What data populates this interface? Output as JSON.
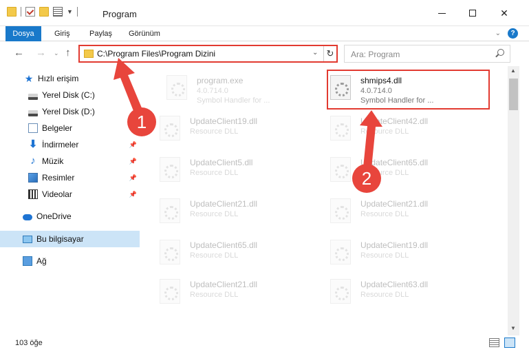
{
  "window": {
    "title": "Program"
  },
  "ribbon": {
    "tabs": [
      "Dosya",
      "Giriş",
      "Paylaş",
      "Görünüm"
    ],
    "help_label": "?"
  },
  "address": {
    "path": "C:\\Program Files\\Program Dizini",
    "search_placeholder": "Ara: Program"
  },
  "sidebar": {
    "items": [
      {
        "label": "Hızlı erişim",
        "icon": "quick-access-star-icon"
      },
      {
        "label": "Yerel Disk (C:)",
        "icon": "local-disk-icon"
      },
      {
        "label": "Yerel Disk (D:)",
        "icon": "local-disk-icon"
      },
      {
        "label": "Belgeler",
        "icon": "documents-icon"
      },
      {
        "label": "İndirmeler",
        "icon": "downloads-icon"
      },
      {
        "label": "Müzik",
        "icon": "music-icon"
      },
      {
        "label": "Resimler",
        "icon": "pictures-icon"
      },
      {
        "label": "Videolar",
        "icon": "videos-icon"
      },
      {
        "label": "OneDrive",
        "icon": "onedrive-cloud-icon"
      },
      {
        "label": "Bu bilgisayar",
        "icon": "this-pc-icon"
      },
      {
        "label": "Ağ",
        "icon": "network-icon"
      }
    ]
  },
  "files": [
    {
      "name": "program.exe",
      "line2": "4.0.714.0",
      "line3": "Symbol Handler for ..."
    },
    {
      "name": "shmips4.dll",
      "line2": "4.0.714.0",
      "line3": "Symbol Handler for ..."
    },
    {
      "name": "UpdateClient19.dll",
      "line2": "Resource DLL"
    },
    {
      "name": "UpdateClient42.dll",
      "line2": "Resource DLL"
    },
    {
      "name": "UpdateClient5.dll",
      "line2": "Resource DLL"
    },
    {
      "name": "UpdateClient65.dll",
      "line2": "Resource DLL"
    },
    {
      "name": "UpdateClient21.dll",
      "line2": "Resource DLL"
    },
    {
      "name": "UpdateClient21.dll",
      "line2": "Resource DLL"
    },
    {
      "name": "UpdateClient65.dll",
      "line2": "Resource DLL"
    },
    {
      "name": "UpdateClient19.dll",
      "line2": "Resource DLL"
    },
    {
      "name": "UpdateClient21.dll",
      "line2": "Resource DLL"
    },
    {
      "name": "UpdateClient63.dll",
      "line2": "Resource DLL"
    }
  ],
  "status": {
    "item_count": "103 öğe"
  },
  "annotations": {
    "step1": "1",
    "step2": "2",
    "color": "#e8453c"
  }
}
